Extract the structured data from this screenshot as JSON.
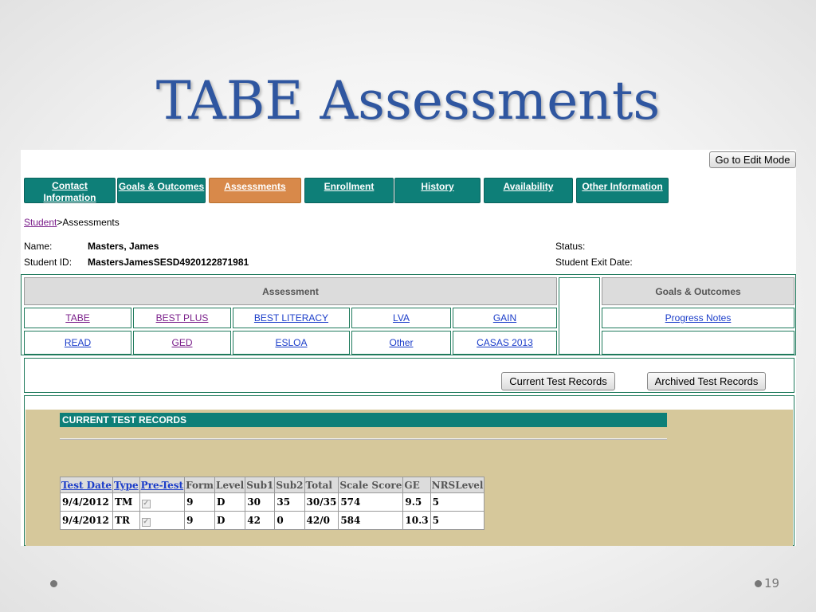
{
  "slide": {
    "title": "TABE Assessments",
    "page_number": "19"
  },
  "app": {
    "edit_mode_label": "Go to Edit Mode",
    "tabs": [
      {
        "label": "Contact Information",
        "active": false
      },
      {
        "label": "Goals & Outcomes",
        "active": false
      },
      {
        "label": "Assessments",
        "active": true
      },
      {
        "label": "Enrollment",
        "active": false
      },
      {
        "label": "History",
        "active": false
      },
      {
        "label": "Availability",
        "active": false
      },
      {
        "label": "Other Information",
        "active": false
      }
    ],
    "breadcrumb": {
      "link": "Student",
      "separator": ">",
      "current": "Assessments"
    },
    "student": {
      "name_label": "Name:",
      "name_value": "Masters, James",
      "id_label": "Student ID:",
      "id_value": "MastersJamesSESD4920122871981",
      "status_label": "Status:",
      "status_value": "",
      "exit_label": "Student Exit Date:",
      "exit_value": ""
    },
    "assessment_header": "Assessment",
    "goals_header": "Goals & Outcomes",
    "assessment_links_row1": [
      "TABE",
      "BEST PLUS",
      "BEST LITERACY",
      "LVA",
      "GAIN"
    ],
    "assessment_links_row2": [
      "READ",
      "GED",
      "ESLOA",
      "Other",
      "CASAS 2013"
    ],
    "goals_links": [
      "Progress Notes"
    ],
    "buttons": {
      "current": "Current Test Records",
      "archived": "Archived Test Records"
    },
    "records": {
      "header": "CURRENT TEST RECORDS",
      "columns": [
        "Test Date",
        "Type",
        "Pre-Test",
        "Form",
        "Level",
        "Sub1",
        "Sub2",
        "Total",
        "Scale Score",
        "GE",
        "NRSLevel"
      ],
      "sortable_columns": [
        "Test Date",
        "Type",
        "Pre-Test"
      ],
      "rows": [
        {
          "date": "9/4/2012",
          "type": "TM",
          "pretest": true,
          "form": "9",
          "level": "D",
          "sub1": "30",
          "sub2": "35",
          "total": "30/35",
          "scale": "574",
          "ge": "9.5",
          "nrs": "5"
        },
        {
          "date": "9/4/2012",
          "type": "TR",
          "pretest": true,
          "form": "9",
          "level": "D",
          "sub1": "42",
          "sub2": "0",
          "total": "42/0",
          "scale": "584",
          "ge": "10.3",
          "nrs": "5"
        }
      ]
    },
    "colors": {
      "tab": "#0e7f78",
      "tab_active": "#d8894a",
      "records_bg": "#d6c89b",
      "title": "#2f56a0"
    }
  }
}
